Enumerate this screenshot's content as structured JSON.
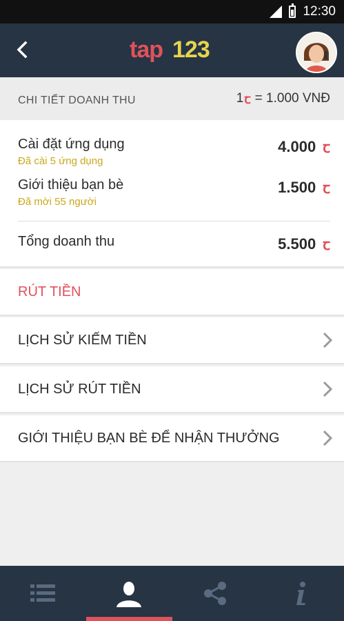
{
  "status_bar": {
    "time": "12:30"
  },
  "app_bar": {
    "logo_text": "tap123"
  },
  "summary": {
    "title": "CHI TIẾT DOANH THU",
    "rate_left": "1",
    "rate_currency": "ꞇ",
    "rate_right": "= 1.000 VNĐ"
  },
  "revenue": {
    "items": [
      {
        "label": "Cài đặt ứng dụng",
        "sub": "Đã cài 5 ứng dụng",
        "amount": "4.000",
        "currency": "ꞇ"
      },
      {
        "label": "Giới thiệu bạn bè",
        "sub": "Đã mời 55 người",
        "amount": "1.500",
        "currency": "ꞇ"
      }
    ],
    "total": {
      "label": "Tổng doanh thu",
      "amount": "5.500",
      "currency": "ꞇ"
    }
  },
  "actions": {
    "withdraw": "RÚT TIỀN",
    "menu": [
      {
        "label": "LỊCH SỬ KIẾM TIỀN"
      },
      {
        "label": "LỊCH SỬ RÚT TIỀN"
      },
      {
        "label": "GIỚI THIỆU BẠN BÈ ĐỂ NHẬN THƯỞNG"
      }
    ]
  },
  "bottom_nav": {
    "tabs": [
      {
        "icon": "list-icon",
        "active": false
      },
      {
        "icon": "profile-icon",
        "active": true
      },
      {
        "icon": "share-icon",
        "active": false
      },
      {
        "icon": "info-icon",
        "active": false
      }
    ]
  },
  "colors": {
    "accent": "#e0525b",
    "bar": "#263444",
    "sub_text": "#c9a81b",
    "logo_accent": "#e8d44d"
  }
}
